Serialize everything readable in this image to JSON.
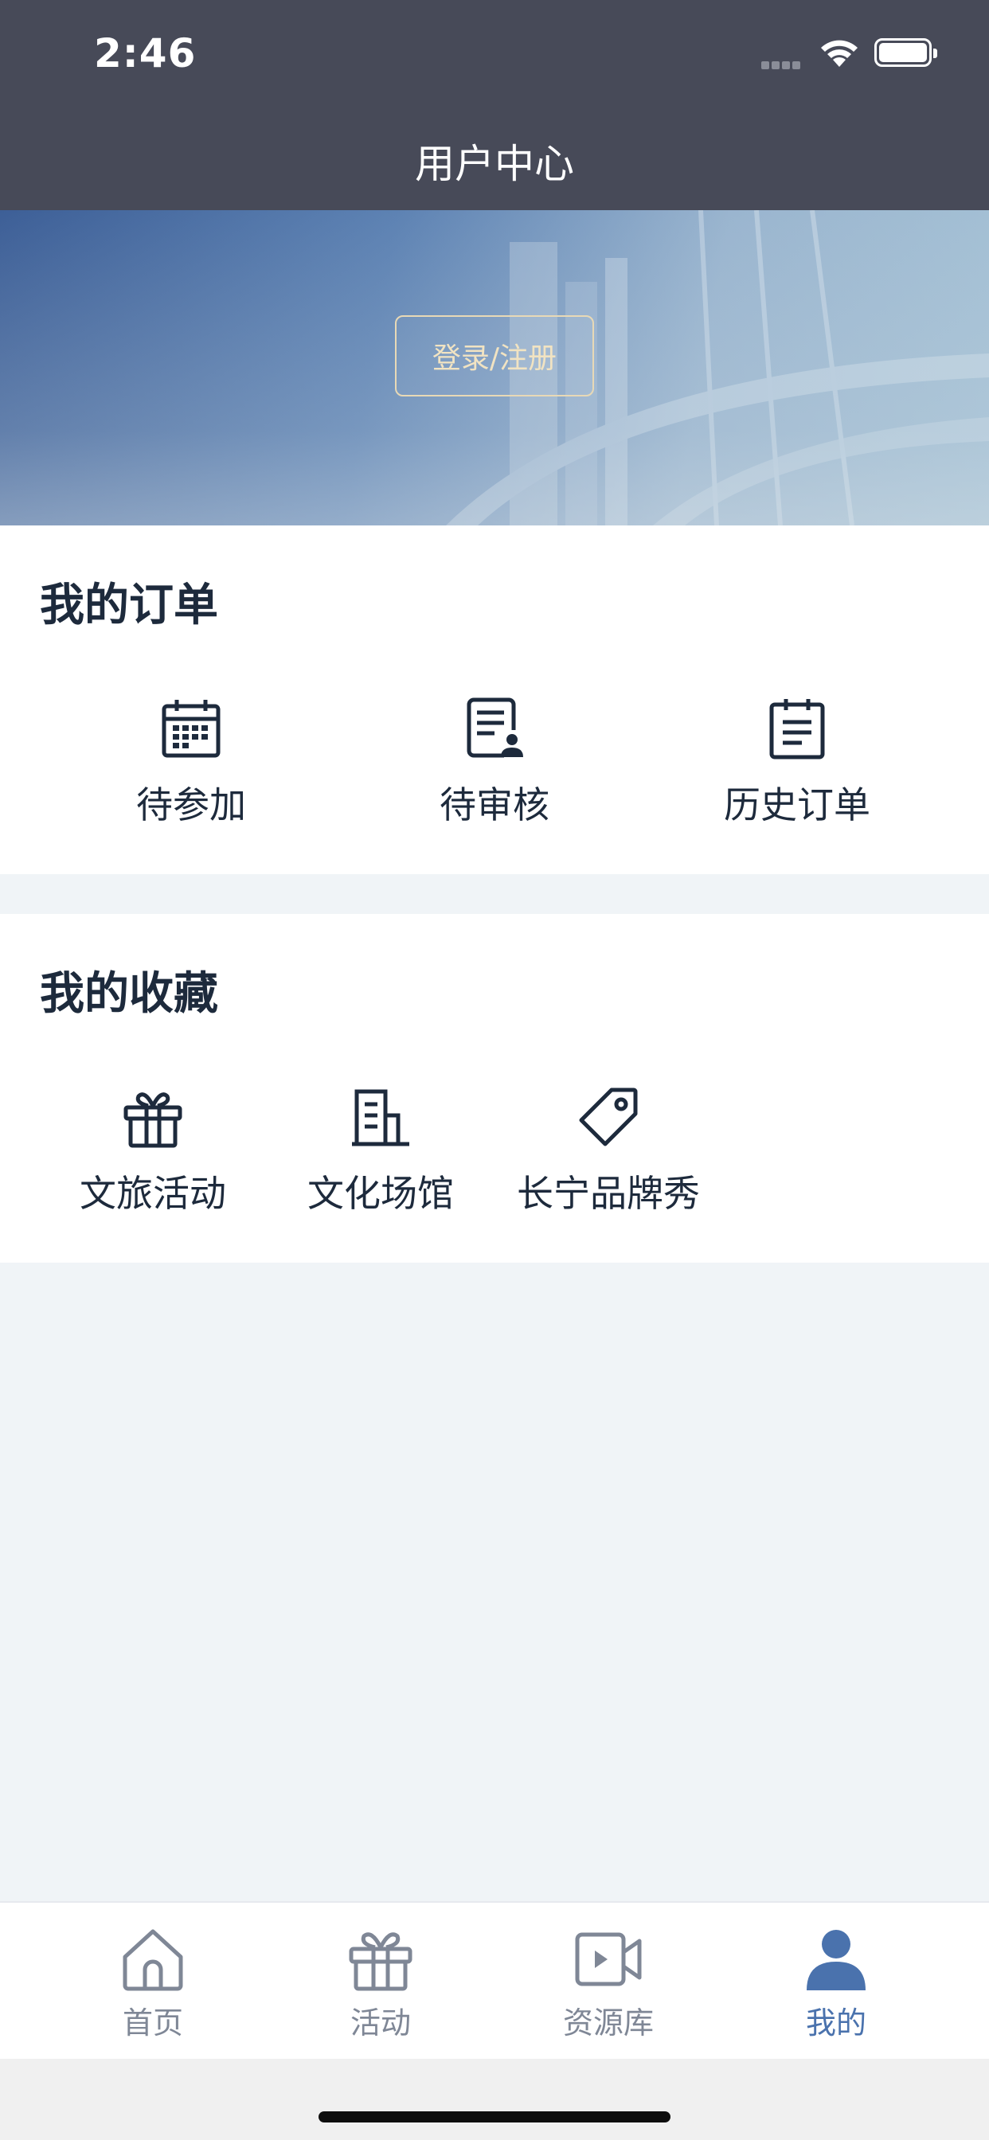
{
  "status_bar": {
    "time": "2:46"
  },
  "header": {
    "title": "用户中心"
  },
  "hero": {
    "login_label": "登录/注册"
  },
  "orders": {
    "title": "我的订单",
    "items": [
      {
        "label": "待参加",
        "icon": "calendar-icon"
      },
      {
        "label": "待审核",
        "icon": "document-user-icon"
      },
      {
        "label": "历史订单",
        "icon": "clipboard-icon"
      }
    ]
  },
  "favorites": {
    "title": "我的收藏",
    "items": [
      {
        "label": "文旅活动",
        "icon": "gift-icon"
      },
      {
        "label": "文化场馆",
        "icon": "building-icon"
      },
      {
        "label": "长宁品牌秀",
        "icon": "tag-icon"
      }
    ]
  },
  "tabbar": {
    "items": [
      {
        "label": "首页",
        "icon": "home-icon"
      },
      {
        "label": "活动",
        "icon": "gift-icon"
      },
      {
        "label": "资源库",
        "icon": "video-icon"
      },
      {
        "label": "我的",
        "icon": "user-icon",
        "active": true
      }
    ]
  },
  "colors": {
    "header_bg": "#474a58",
    "page_bg": "#f0f4f7",
    "text_dark": "#1d2a3c",
    "tab_active": "#4a72ad",
    "tab_inactive": "#7f8796",
    "login_border": "#e8d9b6"
  }
}
